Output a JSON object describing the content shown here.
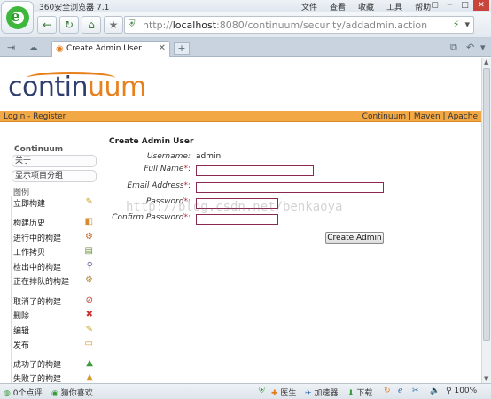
{
  "window": {
    "title": "360安全浏览器 7.1",
    "menus": [
      "文件",
      "查看",
      "收藏",
      "工具",
      "帮助"
    ],
    "buttons": [
      "▢",
      "─",
      "□",
      "✕"
    ]
  },
  "navbar": {
    "back_icon": "←",
    "refresh_icon": "↻",
    "home_icon": "⌂",
    "favorite_icon": "★",
    "address_prefix": "http://",
    "address_host": "localhost",
    "address_rest": ":8080/continuum/security/addadmin.action",
    "addr_icons": [
      "⚡",
      "▾"
    ]
  },
  "tabs": {
    "active_label": "Create Admin User",
    "close_icon": "✕",
    "new_tab_icon": "+"
  },
  "site": {
    "logo_main": "contin",
    "logo_accent": "uum",
    "subnav_left": "Login - Register",
    "subnav_right": "Continuum | Maven | Apache"
  },
  "sidebar": {
    "title": "Continuum",
    "boxes": [
      "关于",
      "显示项目分组"
    ],
    "section": "图例",
    "items": [
      {
        "label": "立即构建",
        "icon": "✎",
        "color": "#c9a227"
      },
      {
        "label": "构建历史",
        "icon": "◧",
        "color": "#d88b2e"
      },
      {
        "label": "进行中的构建",
        "icon": "⚙",
        "color": "#c76a2a"
      },
      {
        "label": "工作拷贝",
        "icon": "▤",
        "color": "#6a8f3a"
      },
      {
        "label": "检出中的构建",
        "icon": "⚲",
        "color": "#7d6aa8"
      },
      {
        "label": "正在排队的构建",
        "icon": "⚙",
        "color": "#b08a3a"
      },
      {
        "label": "取消了的构建",
        "icon": "⊘",
        "color": "#c0392b"
      },
      {
        "label": "删除",
        "icon": "✖",
        "color": "#d0312d"
      },
      {
        "label": "编辑",
        "icon": "✎",
        "color": "#c9a227"
      },
      {
        "label": "发布",
        "icon": "▭",
        "color": "#d88b2e"
      },
      {
        "label": "成功了的构建",
        "icon": "▲",
        "color": "#3d9a3d"
      },
      {
        "label": "失败了的构建",
        "icon": "▲",
        "color": "#d89b2e"
      }
    ]
  },
  "form": {
    "title": "Create Admin User",
    "username_label": "Username:",
    "username_value": "admin",
    "fullname_label": "Full Name",
    "email_label": "Email Address",
    "password_label": "Password",
    "confirm_label": "Confirm Password",
    "required_mark": "*:",
    "submit_label": "Create Admin"
  },
  "watermark": "http://blog.csdn.net/benkaoya",
  "statusbar": {
    "left1": "0个点评",
    "left2": "猜你喜欢",
    "doctor": "医生",
    "accelerator": "加速器",
    "download": "下载",
    "zoom": "100%"
  }
}
